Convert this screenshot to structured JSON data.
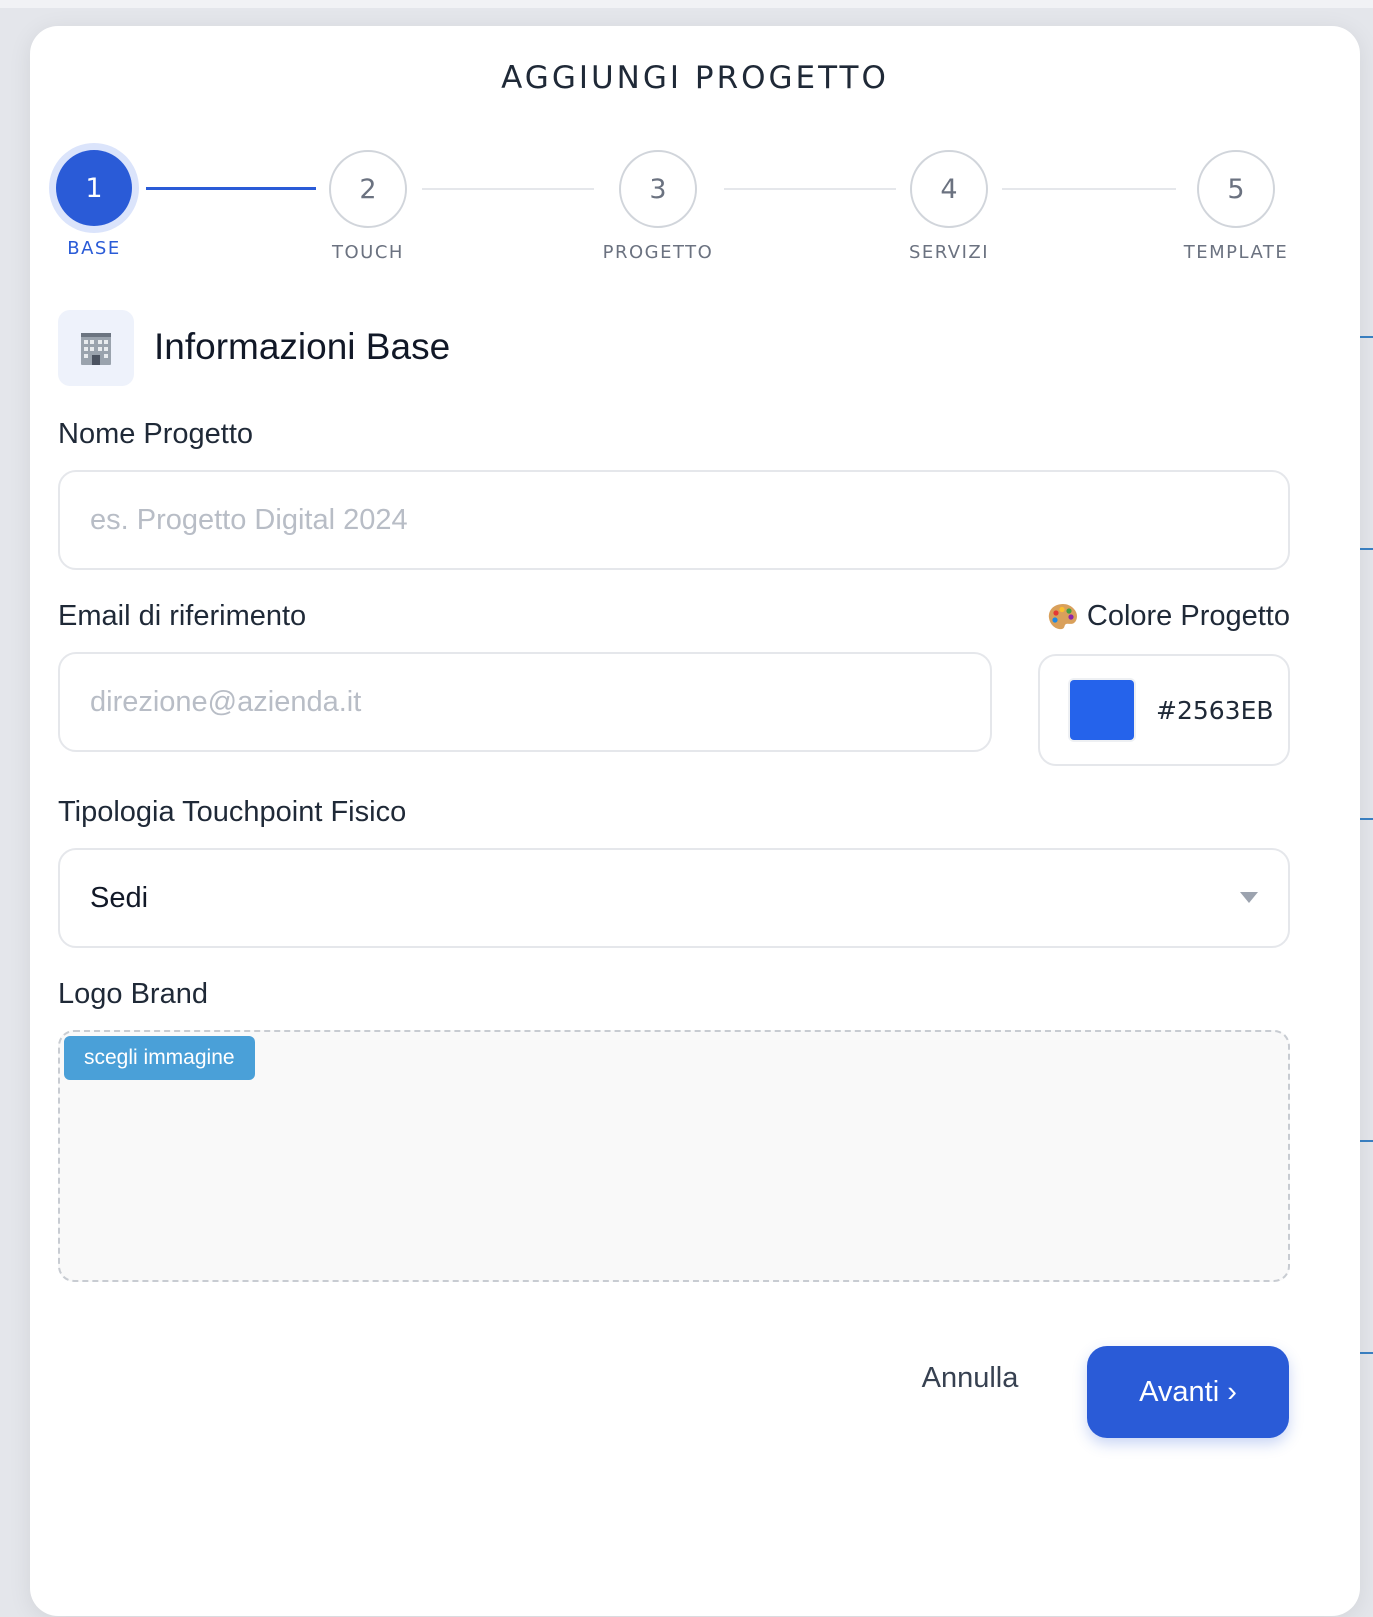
{
  "modal": {
    "title": "AGGIUNGI PROGETTO"
  },
  "stepper": {
    "steps": [
      {
        "number": "1",
        "label": "BASE",
        "active": true
      },
      {
        "number": "2",
        "label": "TOUCH",
        "active": false
      },
      {
        "number": "3",
        "label": "PROGETTO",
        "active": false
      },
      {
        "number": "4",
        "label": "SERVIZI",
        "active": false
      },
      {
        "number": "5",
        "label": "TEMPLATE",
        "active": false
      }
    ]
  },
  "section": {
    "icon": "office-building-icon",
    "title": "Informazioni Base"
  },
  "fields": {
    "project_name": {
      "label": "Nome Progetto",
      "value": "",
      "placeholder": "es. Progetto Digital 2024"
    },
    "email": {
      "label": "Email di riferimento",
      "value": "",
      "placeholder": "direzione@azienda.it"
    },
    "color": {
      "icon": "palette-icon",
      "label": "Colore Progetto",
      "value": "#2563EB"
    },
    "touchpoint_type": {
      "label": "Tipologia Touchpoint Fisico",
      "selected": "Sedi"
    },
    "logo": {
      "label": "Logo Brand",
      "button_label": "scegli immagine"
    }
  },
  "actions": {
    "cancel_label": "Annulla",
    "next_label": "Avanti ›"
  },
  "colors": {
    "accent": "#2A5BD7",
    "project_color": "#2563EB",
    "upload_button": "#4AA0D8"
  }
}
